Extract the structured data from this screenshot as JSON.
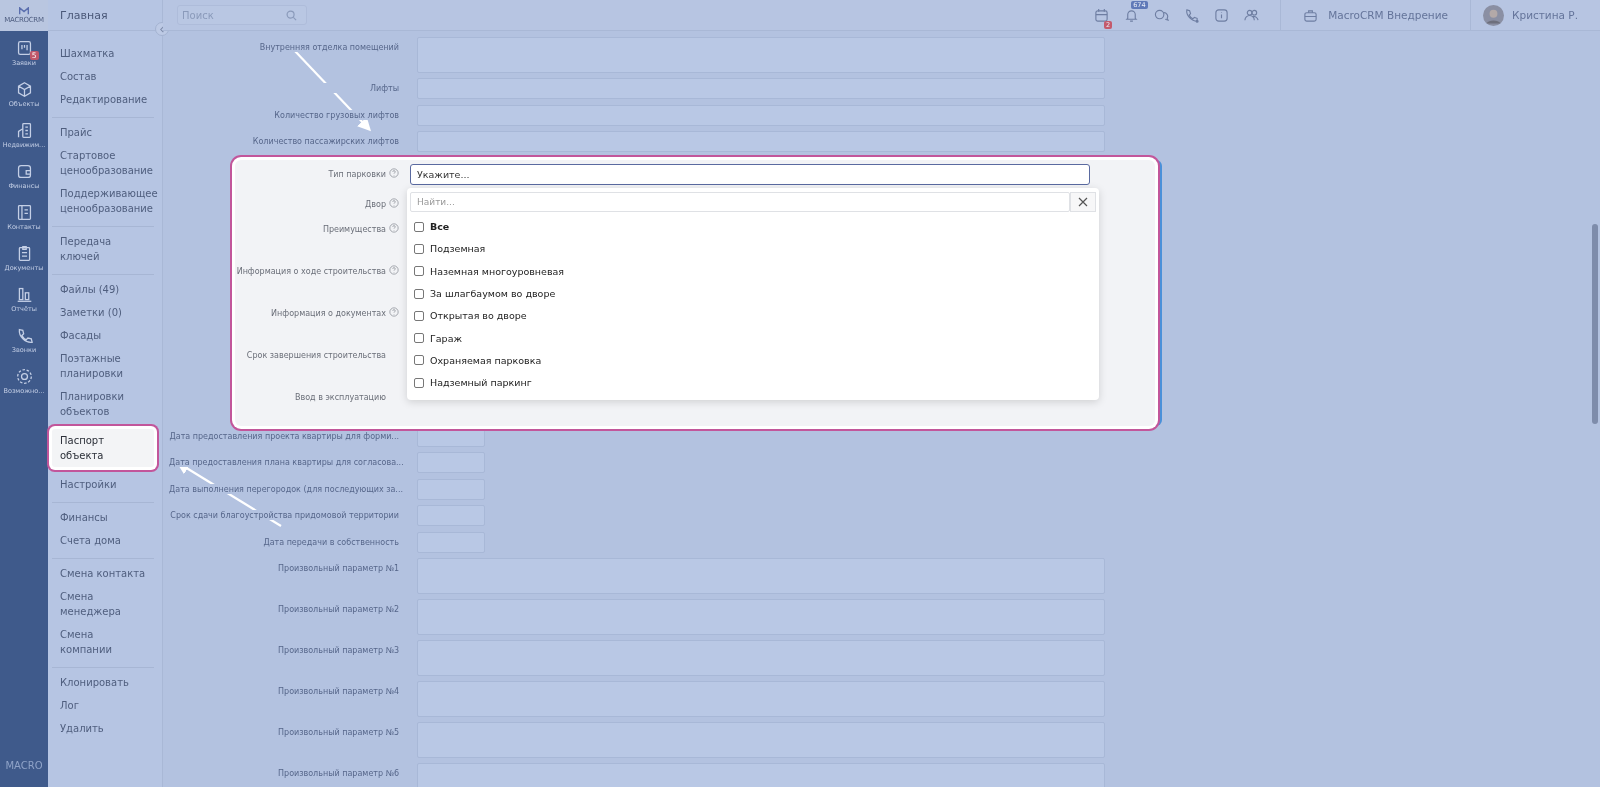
{
  "rail": {
    "logo": "MACROCRM",
    "items": [
      {
        "kind": "requests",
        "label": "Заявки",
        "badge": "5"
      },
      {
        "kind": "box",
        "label": "Объекты"
      },
      {
        "kind": "building",
        "label": "Недвижим..."
      },
      {
        "kind": "wallet",
        "label": "Финансы"
      },
      {
        "kind": "contacts",
        "label": "Контакты"
      },
      {
        "kind": "clipboard",
        "label": "Документы"
      },
      {
        "kind": "chart",
        "label": "Отчёты"
      },
      {
        "kind": "phone",
        "label": "Звонки"
      },
      {
        "kind": "gear",
        "label": "Возможно..."
      }
    ],
    "footer": "MACRO"
  },
  "sidebar": {
    "title": "Главная",
    "groups": [
      [
        {
          "label": "Шахматка",
          "selected": false
        },
        {
          "label": "Состав",
          "selected": false
        },
        {
          "label": "Редактирование",
          "selected": false
        }
      ],
      [
        {
          "label": "Прайс",
          "selected": false
        },
        {
          "label": "Стартовое ценообразование",
          "selected": false
        },
        {
          "label": "Поддерживающее ценообразование",
          "selected": false
        }
      ],
      [
        {
          "label": "Передача ключей",
          "selected": false
        }
      ],
      [
        {
          "label": "Файлы (49)",
          "selected": false
        },
        {
          "label": "Заметки (0)",
          "selected": false
        },
        {
          "label": "Фасады",
          "selected": false
        },
        {
          "label": "Поэтажные планировки",
          "selected": false
        },
        {
          "label": "Планировки объектов",
          "selected": false
        },
        {
          "label": "Паспорт объекта",
          "selected": true
        },
        {
          "label": "Настройки",
          "selected": false
        }
      ],
      [
        {
          "label": "Финансы",
          "selected": false
        },
        {
          "label": "Счета дома",
          "selected": false
        }
      ],
      [
        {
          "label": "Смена контакта",
          "selected": false
        },
        {
          "label": "Смена менеджера",
          "selected": false
        },
        {
          "label": "Смена компании",
          "selected": false
        }
      ],
      [
        {
          "label": "Клонировать",
          "selected": false
        },
        {
          "label": "Лог",
          "selected": false
        },
        {
          "label": "Удалить",
          "selected": false
        }
      ]
    ]
  },
  "topbar": {
    "search": {
      "placeholder": "Поиск"
    },
    "icons": [
      {
        "kind": "calendar",
        "badge": "2"
      },
      {
        "kind": "bell",
        "badge": "674"
      },
      {
        "kind": "chat"
      },
      {
        "kind": "phone"
      },
      {
        "kind": "info"
      },
      {
        "kind": "people"
      }
    ],
    "workspace": "MacroCRM Внедрение",
    "user": "Кристина Р."
  },
  "form": {
    "rows_before": [
      {
        "label": "Внутренняя отделка помещений",
        "kind": "textarea"
      },
      {
        "label": "Лифты",
        "kind": "input"
      },
      {
        "label": "Количество грузовых лифтов",
        "kind": "input"
      },
      {
        "label": "Количество пассажирских лифтов",
        "kind": "input"
      }
    ],
    "highlight": {
      "select": {
        "label": "Тип парковки",
        "help": true,
        "placeholder": "Укажите..."
      },
      "rows": [
        {
          "label": "Двор",
          "help": true,
          "kind": "input"
        },
        {
          "label": "Преимущества",
          "help": true,
          "kind": "textarea"
        },
        {
          "label": "Информация о ходе строительства",
          "help": true,
          "kind": "textarea"
        },
        {
          "label": "Информация о документах",
          "help": true,
          "kind": "textarea"
        },
        {
          "label": "Срок завершения строительства",
          "help": false,
          "kind": "textarea"
        },
        {
          "label": "Ввод в эксплуатацию",
          "help": false,
          "kind": "input"
        }
      ],
      "dropdown": {
        "search_placeholder": "Найти...",
        "options": [
          {
            "kind": "all",
            "label": "Все",
            "checked": false
          },
          {
            "kind": "option",
            "label": "Подземная",
            "checked": false
          },
          {
            "kind": "option",
            "label": "Наземная многоуровневая",
            "checked": false
          },
          {
            "kind": "option",
            "label": "За шлагбаумом во дворе",
            "checked": false
          },
          {
            "kind": "option",
            "label": "Открытая во дворе",
            "checked": false
          },
          {
            "kind": "option",
            "label": "Гараж",
            "checked": false
          },
          {
            "kind": "option",
            "label": "Охраняемая парковка",
            "checked": false
          },
          {
            "kind": "option",
            "label": "Надземный паркинг",
            "checked": false
          }
        ]
      }
    },
    "rows_after": [
      {
        "label": "Дата предоставления проекта квартиры для форми...",
        "kind": "date"
      },
      {
        "label": "Дата предоставления плана квартиры для согласова...",
        "kind": "date"
      },
      {
        "label": "Дата выполнения перегородок (для последующих за...",
        "kind": "date"
      },
      {
        "label": "Срок сдачи благоустройства придомовой территории",
        "kind": "date"
      },
      {
        "label": "Дата передачи в собственность",
        "kind": "date"
      },
      {
        "label": "Произвольный параметр №1",
        "kind": "textarea"
      },
      {
        "label": "Произвольный параметр №2",
        "kind": "textarea"
      },
      {
        "label": "Произвольный параметр №3",
        "kind": "textarea"
      },
      {
        "label": "Произвольный параметр №4",
        "kind": "textarea"
      },
      {
        "label": "Произвольный параметр №5",
        "kind": "textarea"
      },
      {
        "label": "Произвольный параметр №6",
        "kind": "textarea"
      }
    ]
  }
}
